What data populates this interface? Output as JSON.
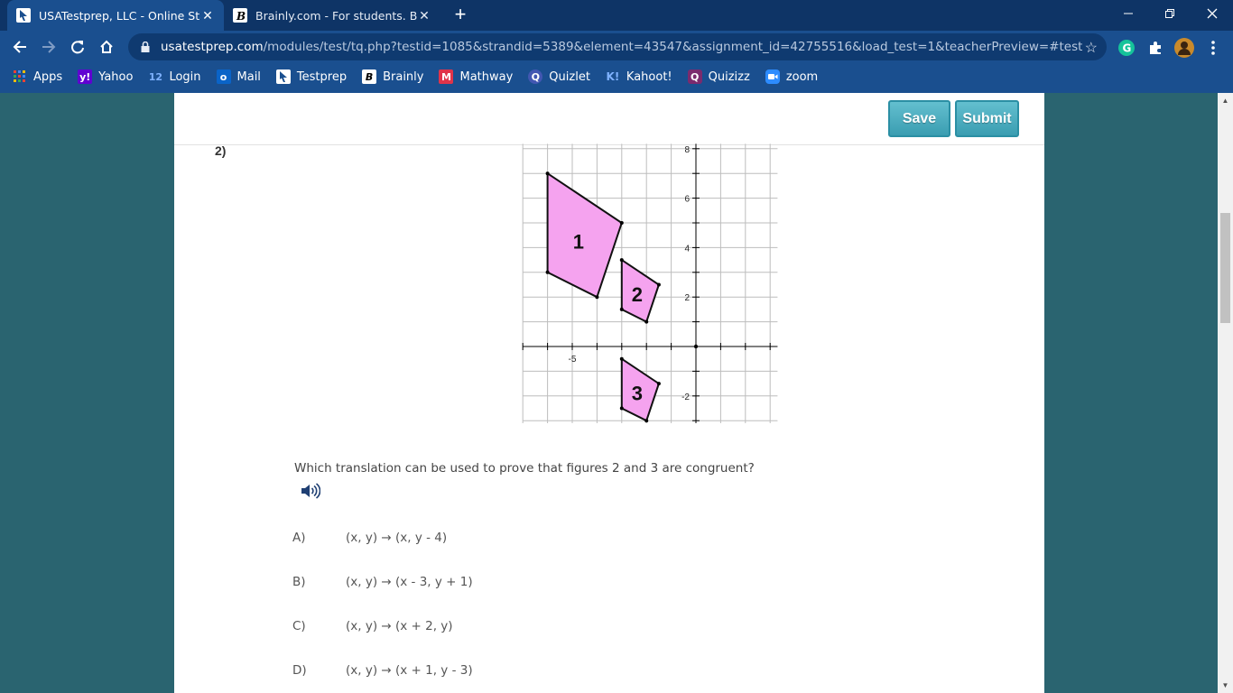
{
  "browser": {
    "tabs": [
      {
        "title": "USATestprep, LLC - Online State-S",
        "active": true,
        "favicon": "usatestprep-icon"
      },
      {
        "title": "Brainly.com - For students. By stu",
        "active": false,
        "favicon": "brainly-icon"
      }
    ],
    "url": {
      "host": "usatestprep.com",
      "path": "/modules/test/tq.php?testid=1085&strandid=5389&element=43547&assignment_id=42755516&load_test=1&teacherPreview=#test"
    },
    "bookmarks": [
      {
        "label": "Apps",
        "icon": "apps-grid-icon"
      },
      {
        "label": "Yahoo",
        "icon": "yahoo-icon"
      },
      {
        "label": "Login",
        "icon": "login-12-icon"
      },
      {
        "label": "Mail",
        "icon": "outlook-icon"
      },
      {
        "label": "Testprep",
        "icon": "usatestprep-icon"
      },
      {
        "label": "Brainly",
        "icon": "brainly-icon"
      },
      {
        "label": "Mathway",
        "icon": "mathway-icon"
      },
      {
        "label": "Quizlet",
        "icon": "quizlet-icon"
      },
      {
        "label": "Kahoot!",
        "icon": "kahoot-icon"
      },
      {
        "label": "Quizizz",
        "icon": "quizizz-icon"
      },
      {
        "label": "zoom",
        "icon": "zoom-icon"
      }
    ]
  },
  "actions": {
    "save_label": "Save",
    "submit_label": "Submit"
  },
  "question": {
    "number": "2)",
    "text": "Which translation can be used to prove that figures 2 and 3 are congruent?",
    "choices": [
      {
        "letter": "A)",
        "text": "(x, y) → (x, y - 4)"
      },
      {
        "letter": "B)",
        "text": "(x, y) → (x - 3, y + 1)"
      },
      {
        "letter": "C)",
        "text": "(x, y) → (x + 2, y)"
      },
      {
        "letter": "D)",
        "text": "(x, y) → (x + 1, y - 3)"
      }
    ]
  },
  "graph": {
    "x_tick_labels": [
      "-5"
    ],
    "y_tick_labels": [
      "8",
      "6",
      "4",
      "2",
      "-2"
    ],
    "figures": [
      {
        "label": "1",
        "points": [
          [
            -6,
            7
          ],
          [
            -3,
            5
          ],
          [
            -4,
            2
          ],
          [
            -6,
            3
          ]
        ]
      },
      {
        "label": "2",
        "points": [
          [
            -3,
            3.5
          ],
          [
            -1.5,
            2.5
          ],
          [
            -2,
            1
          ],
          [
            -3,
            1.5
          ]
        ]
      },
      {
        "label": "3",
        "points": [
          [
            -3,
            -0.5
          ],
          [
            -1.5,
            -1.5
          ],
          [
            -2,
            -3
          ],
          [
            -3,
            -2.5
          ]
        ]
      }
    ],
    "fill_color": "#f5a3ef",
    "stroke_color": "#111111"
  },
  "colors": {
    "button": "#3a9db1",
    "chrome_dark": "#0e3466",
    "chrome": "#1a4f8f",
    "backdrop": "#2a6470"
  }
}
